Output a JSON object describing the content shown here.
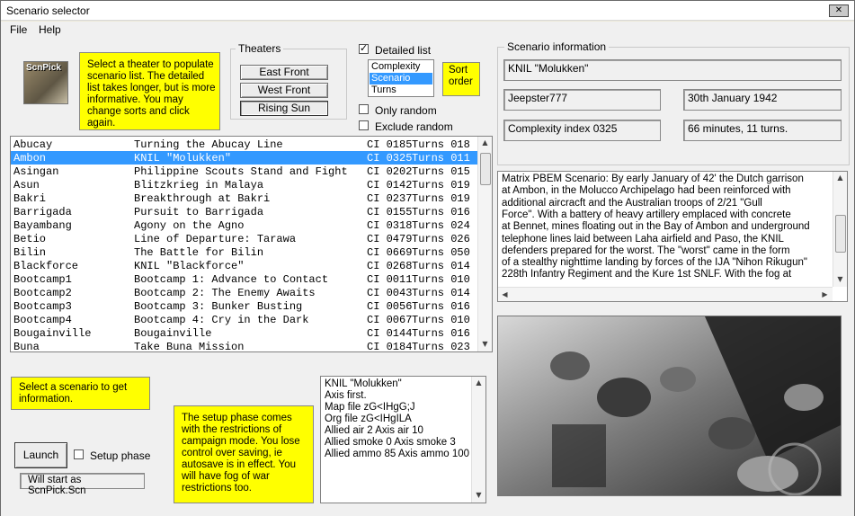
{
  "window": {
    "title": "Scenario selector"
  },
  "menu": [
    "File",
    "Help"
  ],
  "logo_text": "ScnPick",
  "hint_theater": "Select a theater to populate scenario list. The detailed list takes longer, but is more informative. You may change sorts and click again.",
  "theaters": {
    "label": "Theaters",
    "buttons": [
      "East Front",
      "West Front",
      "Rising Sun"
    ]
  },
  "detailed_list": {
    "label": "Detailed list",
    "checked": true
  },
  "sort": {
    "options": [
      "Complexity",
      "Scenario",
      "Turns"
    ],
    "selected": "Scenario",
    "label": "Sort order"
  },
  "only_random": {
    "label": "Only random",
    "checked": false
  },
  "exclude_random": {
    "label": "Exclude random",
    "checked": false
  },
  "scenarios": [
    {
      "code": "Abucay",
      "title": "Turning the Abucay Line",
      "ci": "CI 0185",
      "turns": "Turns 018"
    },
    {
      "code": "Ambon",
      "title": "KNIL \"Molukken\"",
      "ci": "CI 0325",
      "turns": "Turns 011",
      "selected": true
    },
    {
      "code": "Asingan",
      "title": "Philippine Scouts Stand and Fight",
      "ci": "CI 0202",
      "turns": "Turns 015"
    },
    {
      "code": "Asun",
      "title": "Blitzkrieg in Malaya",
      "ci": "CI 0142",
      "turns": "Turns 019"
    },
    {
      "code": "Bakri",
      "title": "Breakthrough at Bakri",
      "ci": "CI 0237",
      "turns": "Turns 019"
    },
    {
      "code": "Barrigada",
      "title": "Pursuit to Barrigada",
      "ci": "CI 0155",
      "turns": "Turns 016"
    },
    {
      "code": "Bayambang",
      "title": "Agony on the Agno",
      "ci": "CI 0318",
      "turns": "Turns 024"
    },
    {
      "code": "Betio",
      "title": "Line of Departure: Tarawa",
      "ci": "CI 0479",
      "turns": "Turns 026"
    },
    {
      "code": "Bilin",
      "title": "The Battle for Bilin",
      "ci": "CI 0669",
      "turns": "Turns 050"
    },
    {
      "code": "Blackforce",
      "title": "KNIL \"Blackforce\"",
      "ci": "CI 0268",
      "turns": "Turns 014"
    },
    {
      "code": "Bootcamp1",
      "title": "Bootcamp 1: Advance to Contact",
      "ci": "CI 0011",
      "turns": "Turns 010"
    },
    {
      "code": "Bootcamp2",
      "title": "Bootcamp 2: The Enemy Awaits",
      "ci": "CI 0043",
      "turns": "Turns 014"
    },
    {
      "code": "Bootcamp3",
      "title": "Bootcamp 3: Bunker Busting",
      "ci": "CI 0056",
      "turns": "Turns 016"
    },
    {
      "code": "Bootcamp4",
      "title": "Bootcamp 4: Cry in the Dark",
      "ci": "CI 0067",
      "turns": "Turns 010"
    },
    {
      "code": "Bougainville",
      "title": "Bougainville",
      "ci": "CI 0144",
      "turns": "Turns 016"
    },
    {
      "code": "Buna",
      "title": "Take Buna Mission",
      "ci": "CI 0184",
      "turns": "Turns 023"
    }
  ],
  "info": {
    "label": "Scenario information",
    "name": "KNIL \"Molukken\"",
    "author": "Jeepster777",
    "date": "30th January 1942",
    "complexity": "Complexity index 0325",
    "duration": "66 minutes, 11 turns.",
    "description": [
      "Matrix PBEM Scenario: By early January of 42' the Dutch garrison",
      "at Ambon, in the Molucco Archipelago had been reinforced with",
      "additional aircracft and the Australian troops of 2/21 \"Gull",
      "Force\". With a battery of heavy artillery emplaced with concrete",
      "at Bennet, mines floating out in the Bay of Ambon and underground",
      "telephone lines laid between Laha airfield and Paso, the KNIL",
      "defenders prepared for the worst. The \"worst\" came in the form",
      "of a stealthy nighttime landing by forces of the IJA \"Nihon Rikugun\"",
      "228th Infantry Regiment and the Kure 1st SNLF. With the fog at"
    ]
  },
  "hint_scenario": "Select a scenario to get information.",
  "hint_setup": "The setup phase comes with the restrictions of campaign mode.  You lose control over saving, ie autosave is in effect.  You will have fog of war restrictions too.",
  "launch": {
    "label": "Launch"
  },
  "setup_phase": {
    "label": "Setup phase",
    "checked": false
  },
  "save_as": "Will start as ScnPick.Scn",
  "details": [
    "KNIL \"Molukken\"",
    "Axis first.",
    "Map file zG<IHgG;J",
    "Org file zG<IHgILA",
    "Allied air 2 Axis air 10",
    "Allied smoke 0 Axis smoke 3",
    "Allied ammo 85 Axis ammo 100"
  ],
  "colors": {
    "selection": "#3399ff",
    "hint": "#ffff00"
  }
}
